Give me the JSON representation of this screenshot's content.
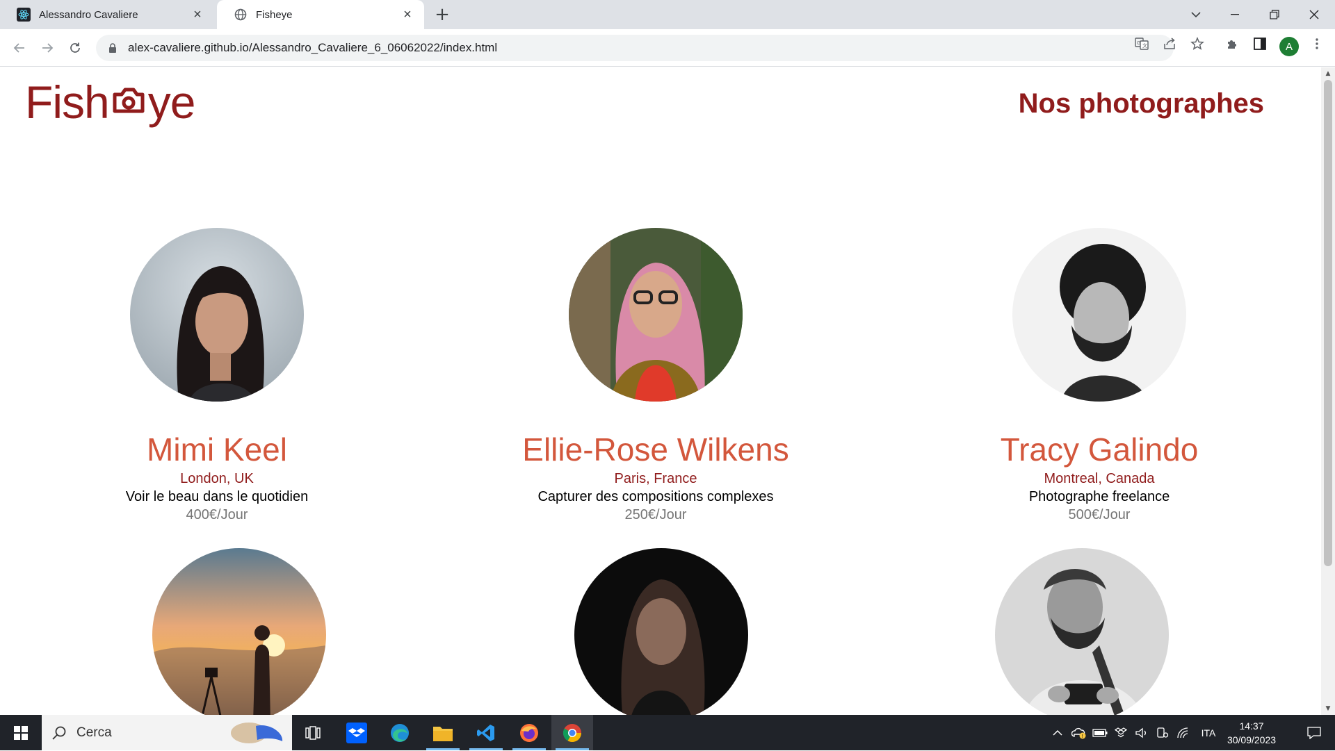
{
  "browser": {
    "tabs": [
      {
        "title": "Alessandro Cavaliere",
        "icon": "react-icon",
        "active": false
      },
      {
        "title": "Fisheye",
        "icon": "globe-icon",
        "active": true
      }
    ],
    "url": "alex-cavaliere.github.io/Alessandro_Cavaliere_6_06062022/index.html",
    "profile_initial": "A"
  },
  "page": {
    "logo_text_left": "Fish",
    "logo_text_right": "ye",
    "title": "Nos photographes"
  },
  "photographers": [
    {
      "name": "Mimi Keel",
      "location": "London, UK",
      "tagline": "Voir le beau dans le quotidien",
      "price": "400€/Jour"
    },
    {
      "name": "Ellie-Rose Wilkens",
      "location": "Paris, France",
      "tagline": "Capturer des compositions complexes",
      "price": "250€/Jour"
    },
    {
      "name": "Tracy Galindo",
      "location": "Montreal, Canada",
      "tagline": "Photographe freelance",
      "price": "500€/Jour"
    },
    {
      "name": "",
      "location": "",
      "tagline": "",
      "price": ""
    },
    {
      "name": "",
      "location": "",
      "tagline": "",
      "price": ""
    },
    {
      "name": "",
      "location": "",
      "tagline": "",
      "price": ""
    }
  ],
  "taskbar": {
    "search_placeholder": "Cerca",
    "language": "ITA",
    "time": "14:37",
    "date": "30/09/2023"
  },
  "colors": {
    "brand_dark": "#901c1c",
    "brand_accent": "#d3573c",
    "price_grey": "#757575"
  }
}
